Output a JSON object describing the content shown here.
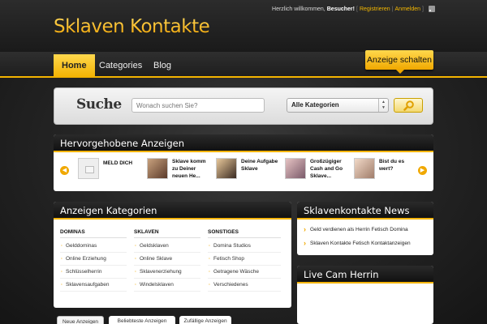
{
  "site": {
    "logo_text": "Sklaven Kontakte"
  },
  "topbar": {
    "greeting": "Herzlich willkommen,",
    "visitor": "Besucher!",
    "sep1": "[",
    "register": "Registrieren",
    "sep2": "|",
    "login": "Anmelden",
    "sep3": "]",
    "rss_icon": "rss-icon"
  },
  "nav": {
    "items": [
      {
        "label": "Home"
      },
      {
        "label": "Categories"
      },
      {
        "label": "Blog"
      }
    ],
    "cta_label": "Anzeige schalten"
  },
  "search": {
    "title": "Suche",
    "input_placeholder": "Wonach suchen Sie?",
    "select_value": "Alle Kategorien",
    "button_icon": "magnifier-icon"
  },
  "featured": {
    "title": "Hervorgehobene Anzeigen",
    "prev_icon": "chevron-left-icon",
    "next_icon": "chevron-right-icon",
    "items": [
      {
        "label": "MELD DICH"
      },
      {
        "label": "Sklave komm zu Deiner neuen He..."
      },
      {
        "label": "Deine Aufgabe Sklave"
      },
      {
        "label": "Großzügiger Cash and Go Sklave..."
      },
      {
        "label": "Bist du es wert?"
      }
    ]
  },
  "categories": {
    "title": "Anzeigen Kategorien",
    "columns": [
      {
        "heading": "DOMINAS",
        "links": [
          "Gelddominas",
          "Online Erziehung",
          "Schlüsselherrin",
          "Sklavensaufgaben"
        ]
      },
      {
        "heading": "SKLAVEN",
        "links": [
          "Geldsklaven",
          "Online Sklave",
          "Sklavenerziehung",
          "Windelsklaven"
        ]
      },
      {
        "heading": "SONSTIGES",
        "links": [
          "Domina Studios",
          "Fetisch Shop",
          "Getragene Wäsche",
          "Verschiedenes"
        ]
      }
    ]
  },
  "news": {
    "title": "Sklavenkontakte News",
    "items": [
      "Geld verdienen als Herrin Fetisch Domina",
      "Sklaven Kontakte Fetisch Kontaktanzeigen"
    ]
  },
  "livecam": {
    "title": "Live Cam Herrin"
  },
  "bottom_tabs": [
    {
      "label": "Neue Anzeigen"
    },
    {
      "label": "Beliebteste Anzeigen"
    },
    {
      "label": "Zufällige Anzeigen"
    }
  ],
  "colors": {
    "accent": "#f4b400",
    "header_bg": "#1e1e1e"
  }
}
